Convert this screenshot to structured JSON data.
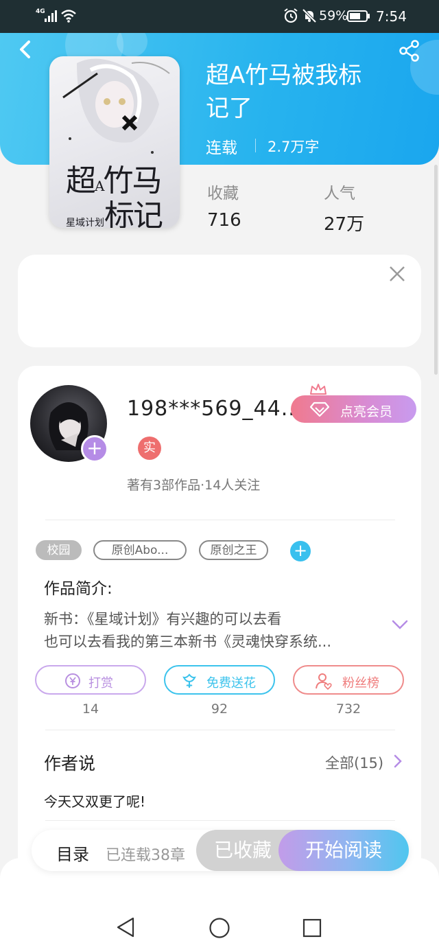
{
  "status_bar": {
    "network": "4G",
    "battery_percent": "59%",
    "time": "7:54"
  },
  "book": {
    "title_line1": "超A竹马被我标",
    "title_line2": "记了",
    "status": "连载",
    "word_count": "2.7万字",
    "cover_title": "超A竹马\n标记了",
    "stats": [
      {
        "label": "收藏",
        "value": "716"
      },
      {
        "label": "人气",
        "value": "27万"
      }
    ]
  },
  "author": {
    "name": "198***569_44...",
    "vip_label": "点亮会员",
    "real_badge": "实",
    "meta": "著有3部作品·14人关注"
  },
  "tags": [
    {
      "label": "校园",
      "filled": true
    },
    {
      "label": "原创Abo...",
      "filled": false
    },
    {
      "label": "原创之王",
      "filled": false
    }
  ],
  "intro": {
    "title": "作品简介:",
    "line1": "新书：《星域计划》有兴趣的可以去看",
    "line2": "也可以去看我的第三本新书《灵魂快穿系统..."
  },
  "actions": [
    {
      "label": "打赏",
      "count": "14",
      "color": "#b88fe0"
    },
    {
      "label": "免费送花",
      "count": "92",
      "color": "#3cc3ec"
    },
    {
      "label": "粉丝榜",
      "count": "732",
      "color": "#ef7d7d"
    }
  ],
  "author_says": {
    "title": "作者说",
    "all_label": "全部(15)",
    "text": "今天又双更了呢!"
  },
  "bottom": {
    "toc": "目录",
    "chapters": "已连载38章",
    "collected": "已收藏",
    "read": "开始阅读"
  },
  "colors": {
    "header": "#27b3ee",
    "accent_purple": "#b58ce6",
    "accent_red": "#ee6e6e"
  }
}
